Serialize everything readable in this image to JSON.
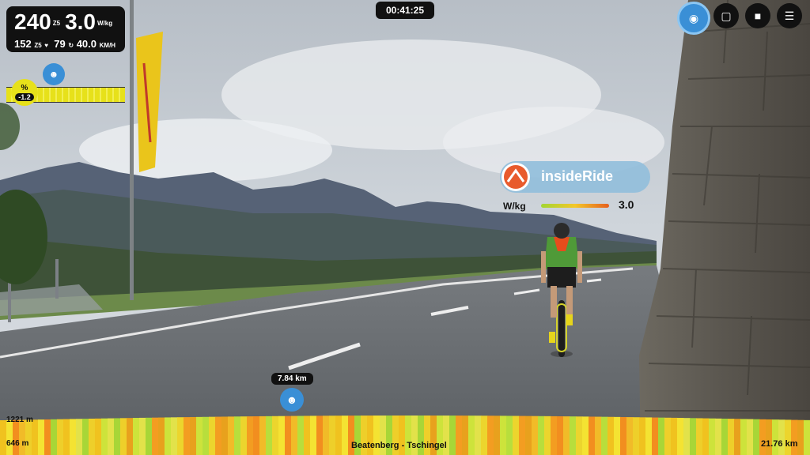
{
  "hud": {
    "power": "240",
    "power_zone": "Z5",
    "wkg": "3.0",
    "wkg_unit": "W/kg",
    "heart_rate": "152",
    "heart_zone": "Z5",
    "cadence": "79",
    "speed": "40.0",
    "speed_unit": "KM/H"
  },
  "timer": "00:41:25",
  "grade": {
    "symbol": "%",
    "value": "-1.2"
  },
  "partner": {
    "name": "insideRide",
    "metric_label": "W/kg",
    "metric_value": "3.0"
  },
  "route": {
    "current_distance": "7.84 km",
    "altitude_max": "1221 m",
    "altitude_min": "646 m",
    "name": "Beatenberg - Tschingel",
    "total_distance": "21.76 km",
    "profile_colors": [
      "#f0c21f",
      "#e8a11d",
      "#f28e1f",
      "#e2e24a",
      "#b8de3c",
      "#eecf2a",
      "#f39d21",
      "#f4e332",
      "#cde33b",
      "#f1bb28",
      "#a8d637",
      "#ecd52d"
    ]
  },
  "icons": {
    "camera_view": "eye-icon",
    "chat": "chat-icon",
    "stop": "stop-icon",
    "menu": "menu-icon"
  }
}
